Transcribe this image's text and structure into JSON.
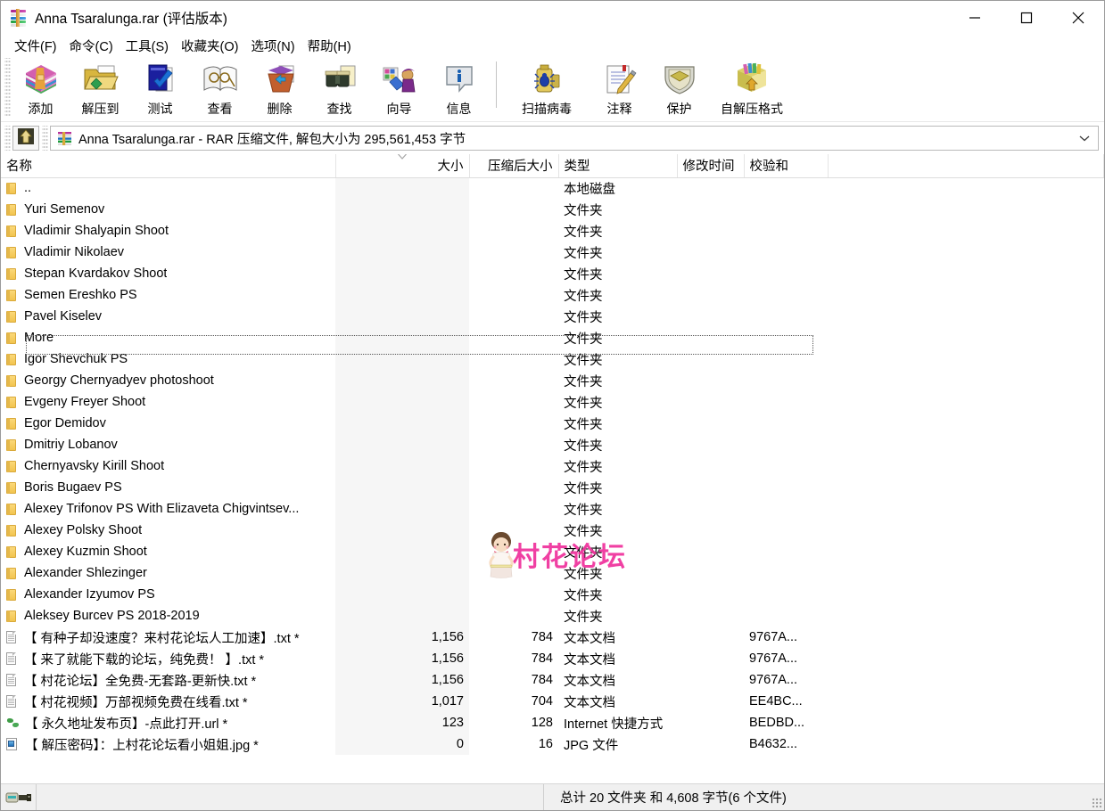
{
  "window": {
    "title": "Anna Tsaralunga.rar (评估版本)",
    "icon": "winrar-icon",
    "controls": [
      {
        "name": "minimize",
        "glyph": "minimize-icon"
      },
      {
        "name": "maximize",
        "glyph": "maximize-icon"
      },
      {
        "name": "close",
        "glyph": "close-icon"
      }
    ]
  },
  "menu": {
    "items": [
      {
        "label": "文件(F)",
        "name": "menu-file"
      },
      {
        "label": "命令(C)",
        "name": "menu-commands"
      },
      {
        "label": "工具(S)",
        "name": "menu-tools"
      },
      {
        "label": "收藏夹(O)",
        "name": "menu-favorites"
      },
      {
        "label": "选项(N)",
        "name": "menu-options"
      },
      {
        "label": "帮助(H)",
        "name": "menu-help"
      }
    ]
  },
  "toolbar": {
    "buttons": [
      {
        "label": "添加",
        "icon": "add-archive-icon"
      },
      {
        "label": "解压到",
        "icon": "extract-to-icon"
      },
      {
        "label": "测试",
        "icon": "test-archive-icon"
      },
      {
        "label": "查看",
        "icon": "view-file-icon"
      },
      {
        "label": "删除",
        "icon": "delete-icon"
      },
      {
        "label": "查找",
        "icon": "find-icon"
      },
      {
        "label": "向导",
        "icon": "wizard-icon"
      },
      {
        "label": "信息",
        "icon": "info-icon"
      }
    ],
    "buttons2": [
      {
        "label": "扫描病毒",
        "icon": "virus-scan-icon"
      },
      {
        "label": "注释",
        "icon": "comment-icon"
      },
      {
        "label": "保护",
        "icon": "protect-icon"
      },
      {
        "label": "自解压格式",
        "icon": "sfx-icon"
      }
    ]
  },
  "address": {
    "up_button": "up-one-level-icon",
    "icon": "winrar-mini-icon",
    "text": "Anna Tsaralunga.rar - RAR 压缩文件, 解包大小为 295,561,453 字节",
    "dropdown": "chevron-down-icon"
  },
  "columns": {
    "name": "名称",
    "size": "大小",
    "packed": "压缩后大小",
    "type": "类型",
    "modified": "修改时间",
    "crc": "校验和",
    "sorted": "name"
  },
  "rows": [
    {
      "icon": "folder-icon",
      "name": "..",
      "size": "",
      "packed": "",
      "type": "本地磁盘",
      "modified": "",
      "crc": "",
      "focused": true
    },
    {
      "icon": "folder-icon",
      "name": "Yuri Semenov",
      "size": "",
      "packed": "",
      "type": "文件夹",
      "modified": "",
      "crc": ""
    },
    {
      "icon": "folder-icon",
      "name": "Vladimir Shalyapin Shoot",
      "size": "",
      "packed": "",
      "type": "文件夹",
      "modified": "",
      "crc": ""
    },
    {
      "icon": "folder-icon",
      "name": "Vladimir Nikolaev",
      "size": "",
      "packed": "",
      "type": "文件夹",
      "modified": "",
      "crc": ""
    },
    {
      "icon": "folder-icon",
      "name": "Stepan Kvardakov Shoot",
      "size": "",
      "packed": "",
      "type": "文件夹",
      "modified": "",
      "crc": ""
    },
    {
      "icon": "folder-icon",
      "name": "Semen Ereshko PS",
      "size": "",
      "packed": "",
      "type": "文件夹",
      "modified": "",
      "crc": ""
    },
    {
      "icon": "folder-icon",
      "name": "Pavel Kiselev",
      "size": "",
      "packed": "",
      "type": "文件夹",
      "modified": "",
      "crc": ""
    },
    {
      "icon": "folder-icon",
      "name": "More",
      "size": "",
      "packed": "",
      "type": "文件夹",
      "modified": "",
      "crc": ""
    },
    {
      "icon": "folder-icon",
      "name": "Igor Shevchuk PS",
      "size": "",
      "packed": "",
      "type": "文件夹",
      "modified": "",
      "crc": ""
    },
    {
      "icon": "folder-icon",
      "name": "Georgy Chernyadyev photoshoot",
      "size": "",
      "packed": "",
      "type": "文件夹",
      "modified": "",
      "crc": ""
    },
    {
      "icon": "folder-icon",
      "name": "Evgeny Freyer Shoot",
      "size": "",
      "packed": "",
      "type": "文件夹",
      "modified": "",
      "crc": ""
    },
    {
      "icon": "folder-icon",
      "name": "Egor Demidov",
      "size": "",
      "packed": "",
      "type": "文件夹",
      "modified": "",
      "crc": ""
    },
    {
      "icon": "folder-icon",
      "name": "Dmitriy Lobanov",
      "size": "",
      "packed": "",
      "type": "文件夹",
      "modified": "",
      "crc": ""
    },
    {
      "icon": "folder-icon",
      "name": "Chernyavsky Kirill Shoot",
      "size": "",
      "packed": "",
      "type": "文件夹",
      "modified": "",
      "crc": ""
    },
    {
      "icon": "folder-icon",
      "name": "Boris Bugaev PS",
      "size": "",
      "packed": "",
      "type": "文件夹",
      "modified": "",
      "crc": ""
    },
    {
      "icon": "folder-icon",
      "name": "Alexey Trifonov PS With Elizaveta Chigvintsev...",
      "size": "",
      "packed": "",
      "type": "文件夹",
      "modified": "",
      "crc": ""
    },
    {
      "icon": "folder-icon",
      "name": "Alexey Polsky Shoot",
      "size": "",
      "packed": "",
      "type": "文件夹",
      "modified": "",
      "crc": ""
    },
    {
      "icon": "folder-icon",
      "name": "Alexey Kuzmin Shoot",
      "size": "",
      "packed": "",
      "type": "文件夹",
      "modified": "",
      "crc": ""
    },
    {
      "icon": "folder-icon",
      "name": "Alexander Shlezinger",
      "size": "",
      "packed": "",
      "type": "文件夹",
      "modified": "",
      "crc": ""
    },
    {
      "icon": "folder-icon",
      "name": "Alexander Izyumov PS",
      "size": "",
      "packed": "",
      "type": "文件夹",
      "modified": "",
      "crc": ""
    },
    {
      "icon": "folder-icon",
      "name": "Aleksey Burcev PS 2018-2019",
      "size": "",
      "packed": "",
      "type": "文件夹",
      "modified": "",
      "crc": ""
    },
    {
      "icon": "text-file-icon",
      "name": "【 有种子却没速度？来村花论坛人工加速】.txt *",
      "size": "1,156",
      "packed": "784",
      "type": "文本文档",
      "modified": "",
      "crc": "9767A..."
    },
    {
      "icon": "text-file-icon",
      "name": "【 来了就能下载的论坛，纯免费！ 】.txt *",
      "size": "1,156",
      "packed": "784",
      "type": "文本文档",
      "modified": "",
      "crc": "9767A..."
    },
    {
      "icon": "text-file-icon",
      "name": "【 村花论坛】全免费-无套路-更新快.txt *",
      "size": "1,156",
      "packed": "784",
      "type": "文本文档",
      "modified": "",
      "crc": "9767A..."
    },
    {
      "icon": "text-file-icon",
      "name": "【 村花视频】万部视频免费在线看.txt *",
      "size": "1,017",
      "packed": "704",
      "type": "文本文档",
      "modified": "",
      "crc": "EE4BC..."
    },
    {
      "icon": "url-file-icon",
      "name": "【 永久地址发布页】-点此打开.url *",
      "size": "123",
      "packed": "128",
      "type": "Internet 快捷方式",
      "modified": "",
      "crc": "BEDBD..."
    },
    {
      "icon": "jpg-file-icon",
      "name": "【 解压密码】：上村花论坛看小姐姐.jpg *",
      "size": "0",
      "packed": "16",
      "type": "JPG 文件",
      "modified": "",
      "crc": "B4632..."
    }
  ],
  "watermark": {
    "text": "村花论坛",
    "color": "#f0369f"
  },
  "statusbar": {
    "left_icon": "archive-key-icon",
    "summary": "总计 20 文件夹 和 4,608 字节(6 个文件)"
  }
}
